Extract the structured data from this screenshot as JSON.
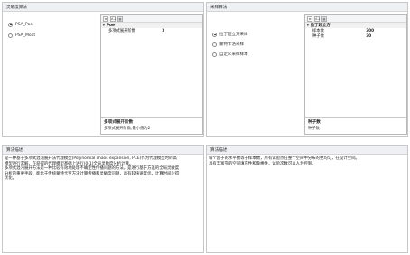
{
  "left_top": {
    "title": "灵敏度算法",
    "options": [
      {
        "label": "PSA_Poe",
        "checked": true
      },
      {
        "label": "PSA_Moat",
        "checked": false
      }
    ],
    "toolbar": [
      "≡",
      "A↓",
      "▦"
    ],
    "category": "Poe",
    "properties": [
      {
        "name": "多项式展开阶数",
        "value": "3"
      }
    ],
    "desc_title": "多项式展开阶数",
    "desc_text": "多项式展开阶数,最小值为2"
  },
  "right_top": {
    "title": "采样算法",
    "options": [
      {
        "label": "拉丁超立方采样",
        "checked": true
      },
      {
        "label": "蒙特卡洛采样",
        "checked": false
      },
      {
        "label": "自定义采样样本",
        "checked": false
      }
    ],
    "toolbar": [
      "≡",
      "A↓",
      "▦"
    ],
    "category": "拉丁超立方",
    "properties": [
      {
        "name": "样本数",
        "value": "300"
      },
      {
        "name": "种子数",
        "value": "30"
      }
    ],
    "desc_title": "种子数",
    "desc_text": "种子数"
  },
  "left_bottom": {
    "title": "算法描述",
    "text": "是一种基于多项式混沌展开法代理模型(Polynomial chaos expansion, PCE)作为代理模型时的高\n模型进行求解，在获得的代理模型基础上进行(0-1)全局灵敏度分析计算。\n多项式混沌展开方法是一种比较有效地处理不确定性传播问题的方法，是进行基于方差的全局灵敏度\n分析的重要手段，能比于传统蒙特卡罗方法计算传播和灵敏度问题，具有较快速度优，计算时间少得\n优化。"
  },
  "right_bottom": {
    "title": "算法描述",
    "text": "每个因子的水平数等于样本数，所有试验点在整个空间中分布的更均匀，在设计空间。\n具有丰富完的空间填充性和鲁棒性，试验次数可以人为控制。"
  }
}
